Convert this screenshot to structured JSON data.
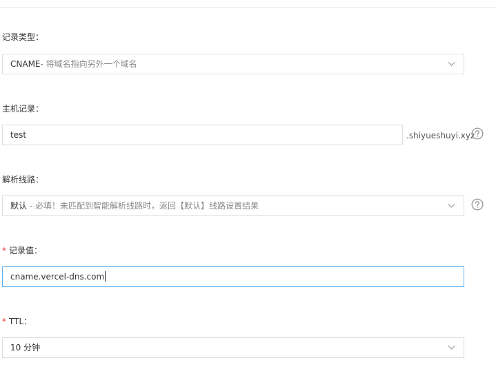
{
  "record_type": {
    "label": "记录类型：",
    "value_main": "CNAME",
    "value_desc": "- 将域名指向另外一个域名"
  },
  "host_record": {
    "label": "主机记录：",
    "value": "test",
    "suffix": ".shiyueshuyi.xyz"
  },
  "resolution_line": {
    "label": "解析线路：",
    "value_main": "默认",
    "value_desc": " - 必填！未匹配到智能解析线路时，返回【默认】线路设置结果"
  },
  "record_value": {
    "required_mark": "*",
    "label": "记录值：",
    "value": "cname.vercel-dns.com"
  },
  "ttl": {
    "required_mark": "*",
    "label": "TTL：",
    "value": "10 分钟"
  },
  "icons": {
    "chevron": "chevron-down-icon",
    "help": "question-circle-icon"
  },
  "colors": {
    "required": "#e4393c",
    "focus_border": "#5aaef0",
    "border": "#dddddd"
  }
}
